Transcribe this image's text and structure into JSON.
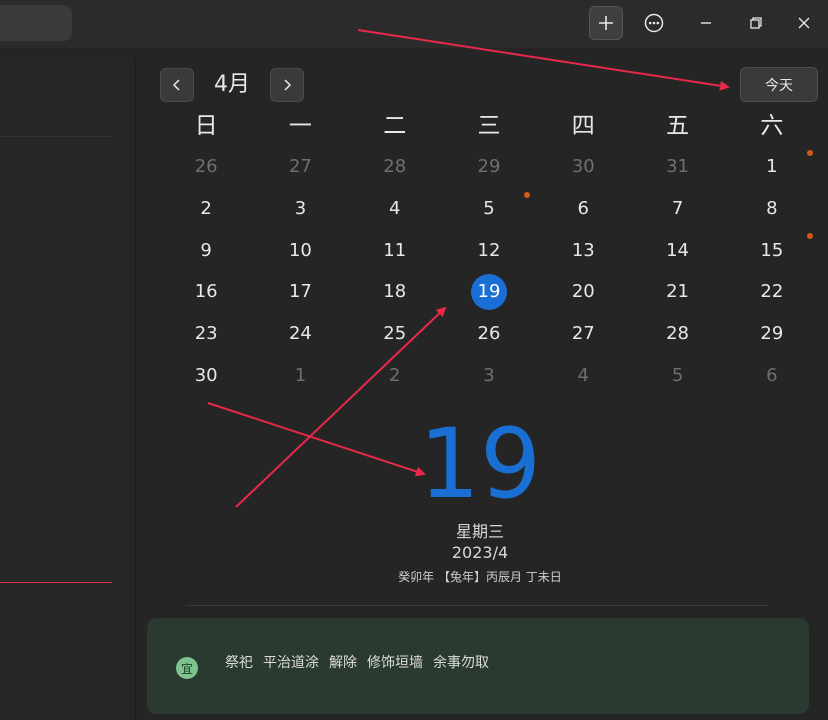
{
  "header": {
    "add_icon": "plus-icon",
    "more_icon": "more-icon",
    "min_icon": "minimize-icon",
    "max_icon": "maximize-icon",
    "close_icon": "close-icon"
  },
  "calendar": {
    "month_label": "4月",
    "today_button": "今天",
    "weekdays": [
      "日",
      "一",
      "二",
      "三",
      "四",
      "五",
      "六"
    ],
    "weeks": [
      [
        {
          "d": "26",
          "other": true
        },
        {
          "d": "27",
          "other": true
        },
        {
          "d": "28",
          "other": true
        },
        {
          "d": "29",
          "other": true
        },
        {
          "d": "30",
          "other": true
        },
        {
          "d": "31",
          "other": true
        },
        {
          "d": "1",
          "other": false,
          "dot": true
        }
      ],
      [
        {
          "d": "2",
          "other": false
        },
        {
          "d": "3",
          "other": false
        },
        {
          "d": "4",
          "other": false
        },
        {
          "d": "5",
          "other": false,
          "dot": true
        },
        {
          "d": "6",
          "other": false
        },
        {
          "d": "7",
          "other": false
        },
        {
          "d": "8",
          "other": false
        }
      ],
      [
        {
          "d": "9",
          "other": false
        },
        {
          "d": "10",
          "other": false
        },
        {
          "d": "11",
          "other": false
        },
        {
          "d": "12",
          "other": false
        },
        {
          "d": "13",
          "other": false
        },
        {
          "d": "14",
          "other": false
        },
        {
          "d": "15",
          "other": false,
          "dot": true
        }
      ],
      [
        {
          "d": "16",
          "other": false
        },
        {
          "d": "17",
          "other": false
        },
        {
          "d": "18",
          "other": false
        },
        {
          "d": "19",
          "other": false,
          "selected": true
        },
        {
          "d": "20",
          "other": false
        },
        {
          "d": "21",
          "other": false
        },
        {
          "d": "22",
          "other": false
        }
      ],
      [
        {
          "d": "23",
          "other": false
        },
        {
          "d": "24",
          "other": false
        },
        {
          "d": "25",
          "other": false
        },
        {
          "d": "26",
          "other": false
        },
        {
          "d": "27",
          "other": false
        },
        {
          "d": "28",
          "other": false
        },
        {
          "d": "29",
          "other": false
        }
      ],
      [
        {
          "d": "30",
          "other": false
        },
        {
          "d": "1",
          "other": true
        },
        {
          "d": "2",
          "other": true
        },
        {
          "d": "3",
          "other": true
        },
        {
          "d": "4",
          "other": true
        },
        {
          "d": "5",
          "other": true
        },
        {
          "d": "6",
          "other": true
        }
      ]
    ]
  },
  "detail": {
    "big_day": "19",
    "weekday_name": "星期三",
    "date_line": "2023/4",
    "lunar_line": "癸卯年 【兔年】丙辰月 丁未日"
  },
  "yi": {
    "badge": "宜",
    "items": [
      "祭祀",
      "平治道涂",
      "解除",
      "修饰垣墙",
      "余事勿取"
    ]
  },
  "colors": {
    "accent": "#1a6fd4",
    "event_dot": "#d35a14",
    "annotation": "#e8284a",
    "yi_bg": "#2b3a30"
  }
}
